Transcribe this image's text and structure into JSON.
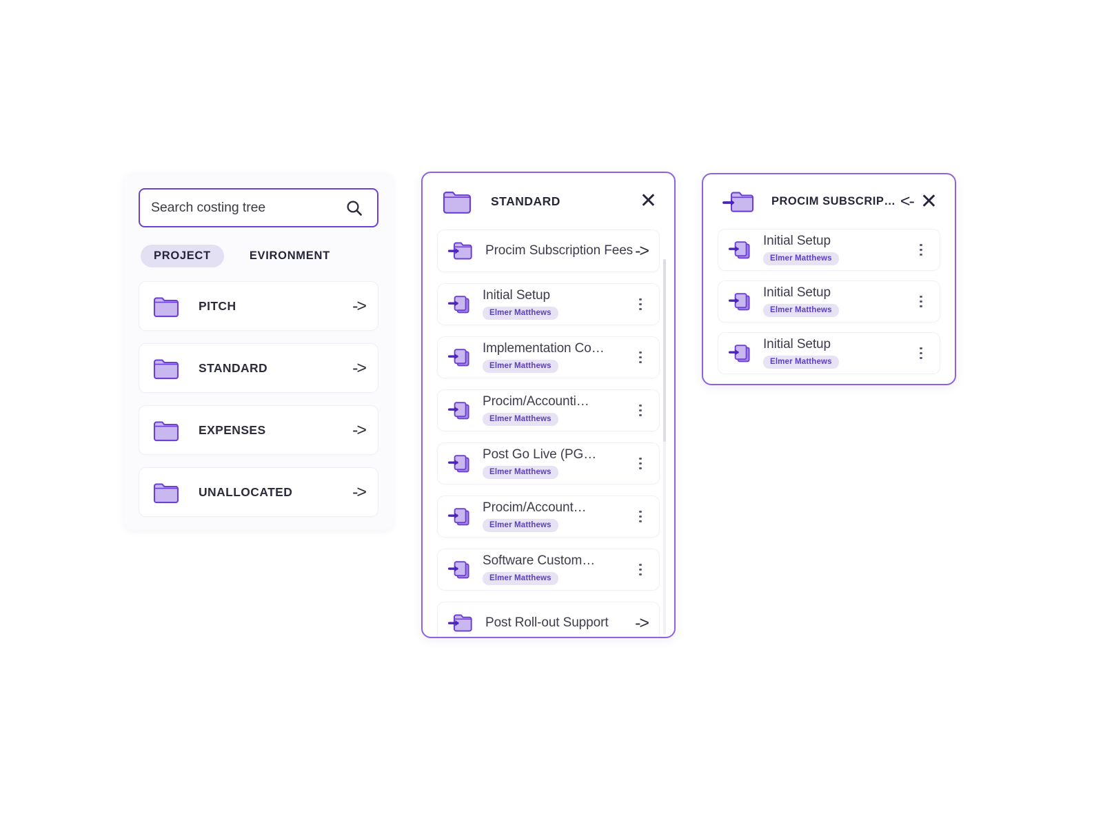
{
  "colors": {
    "accent": "#6c3fd6",
    "panel_border": "#8b63e0",
    "folder_fill": "#c9b8ef",
    "folder_stroke": "#6c3fd6",
    "badge_bg": "#e7e3f5",
    "badge_text": "#5b3ec4",
    "tab_active_bg": "#e4e0f3",
    "text_dark": "#26263a",
    "page_bg": "#ffffff"
  },
  "left_panel": {
    "search": {
      "placeholder": "Search costing tree",
      "value": "",
      "icon": "search-icon"
    },
    "tabs": [
      {
        "label": "PROJECT",
        "active": true
      },
      {
        "label": "EVIRONMENT",
        "active": false
      }
    ],
    "folders": [
      {
        "label": "PITCH",
        "icon": "folder-icon",
        "arrow": "->"
      },
      {
        "label": "STANDARD",
        "icon": "folder-icon",
        "arrow": "->"
      },
      {
        "label": "EXPENSES",
        "icon": "folder-icon",
        "arrow": "->"
      },
      {
        "label": "UNALLOCATED",
        "icon": "folder-icon",
        "arrow": "->"
      }
    ]
  },
  "mid_panel": {
    "header": {
      "title": "STANDARD",
      "icon": "folder-icon",
      "close_label": "✕"
    },
    "items": [
      {
        "type": "folder",
        "title": "Procim Subscription Fees",
        "icon": "folder-enter-icon",
        "arrow": "->"
      },
      {
        "type": "doc",
        "title": "Initial Setup",
        "owner": "Elmer Matthews",
        "icon": "doc-enter-icon",
        "menu": "kebab-icon"
      },
      {
        "type": "doc",
        "title": "Implementation Co…",
        "owner": "Elmer Matthews",
        "icon": "doc-enter-icon",
        "menu": "kebab-icon"
      },
      {
        "type": "doc",
        "title": "Procim/Accounti…",
        "owner": "Elmer Matthews",
        "icon": "doc-enter-icon",
        "menu": "kebab-icon"
      },
      {
        "type": "doc",
        "title": "Post Go Live (PG…",
        "owner": "Elmer Matthews",
        "icon": "doc-enter-icon",
        "menu": "kebab-icon"
      },
      {
        "type": "doc",
        "title": "Procim/Account…",
        "owner": "Elmer Matthews",
        "icon": "doc-enter-icon",
        "menu": "kebab-icon"
      },
      {
        "type": "doc",
        "title": "Software Custom…",
        "owner": "Elmer Matthews",
        "icon": "doc-enter-icon",
        "menu": "kebab-icon"
      },
      {
        "type": "folder",
        "title": "Post Roll-out Support",
        "icon": "folder-enter-icon",
        "arrow": "->"
      }
    ]
  },
  "right_panel": {
    "header": {
      "title": "PROCIM SUBSCRIP…",
      "icon": "folder-enter-icon",
      "back_label": "<-",
      "close_label": "✕"
    },
    "items": [
      {
        "type": "doc",
        "title": "Initial Setup",
        "owner": "Elmer Matthews",
        "icon": "doc-enter-icon",
        "menu": "kebab-icon"
      },
      {
        "type": "doc",
        "title": "Initial Setup",
        "owner": "Elmer Matthews",
        "icon": "doc-enter-icon",
        "menu": "kebab-icon"
      },
      {
        "type": "doc",
        "title": "Initial Setup",
        "owner": "Elmer Matthews",
        "icon": "doc-enter-icon",
        "menu": "kebab-icon"
      }
    ]
  }
}
